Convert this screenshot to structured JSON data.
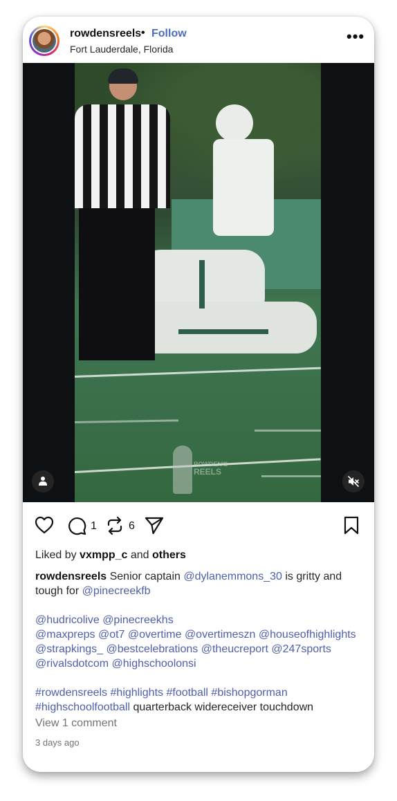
{
  "post": {
    "username": "rowdensreels",
    "separator": "•",
    "follow_label": "Follow",
    "location": "Fort Lauderdale, Florida",
    "more_label": "•••"
  },
  "video": {
    "watermark_line1": "ROWDEN'S",
    "watermark_line2": "REELS",
    "icons": [
      "person-icon",
      "mute-icon"
    ]
  },
  "actions": {
    "comment_count": "1",
    "repost_count": "6",
    "icons": [
      "heart-icon",
      "comment-icon",
      "repost-icon",
      "share-icon",
      "bookmark-icon"
    ]
  },
  "likes": {
    "prefix": "Liked by",
    "user": "vxmpp_c",
    "middle": "and",
    "others": "others"
  },
  "caption": {
    "username": "rowdensreels",
    "text1": "Senior captain",
    "mention1": "@dylanemmons_30",
    "text2": "is gritty and tough for",
    "mention2": "@pinecreekfb",
    "tags_line1": [
      "@hudricolive",
      "@pinecreekhs"
    ],
    "tags_line2": [
      "@maxpreps",
      "@ot7",
      "@overtime",
      "@overtimeszn",
      "@houseofhighlights"
    ],
    "tags_line3": [
      "@strapkings_",
      "@bestcelebrations",
      "@theucreport",
      "@247sports"
    ],
    "tags_line4": [
      "@rivalsdotcom",
      "@highschoolonsi"
    ],
    "hashtags_line1": [
      "#rowdensreels",
      "#highlights",
      "#football",
      "#bishopgorman"
    ],
    "hashtag_last": "#highschoolfootball",
    "tail_text": "quarterback widereceiver touchdown"
  },
  "view_comments": "View 1 comment",
  "timestamp": "3 days ago",
  "colors": {
    "link": "#4e5fab",
    "follow": "#4e6cbf",
    "muted": "#737373"
  }
}
